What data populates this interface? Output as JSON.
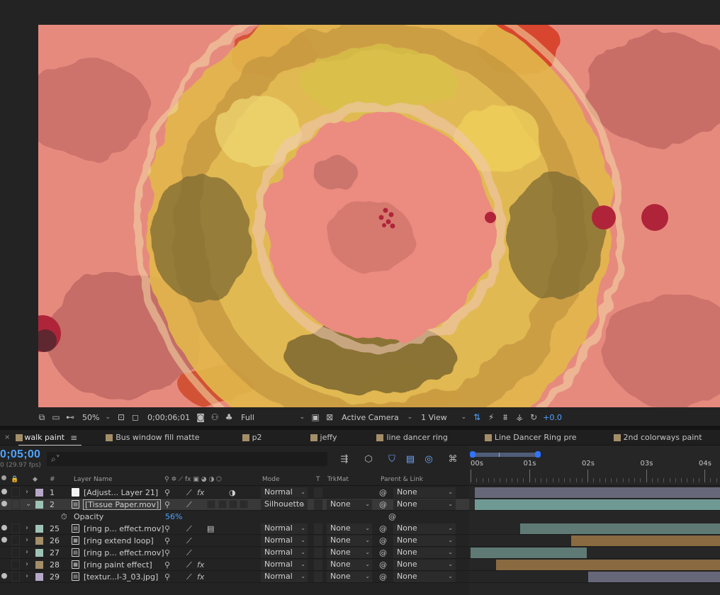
{
  "viewer": {
    "toolbar": {
      "zoom": "50%",
      "timecode": "0;00;06;01",
      "resolution": "Full",
      "camera": "Active Camera",
      "views": "1 View",
      "exposure": "+0.0"
    }
  },
  "tabs": [
    {
      "label": "walk paint",
      "active": true
    },
    {
      "label": "Bus window fill matte"
    },
    {
      "label": "p2"
    },
    {
      "label": "jeffy"
    },
    {
      "label": "line dancer ring"
    },
    {
      "label": "Line Dancer Ring pre"
    },
    {
      "label": "2nd colorways paint"
    }
  ],
  "timeline": {
    "current_time": "0;05;00",
    "fps": "0 (29.97 fps)",
    "search_placeholder": "⌕˅",
    "ruler_labels": [
      "00s",
      "01s",
      "02s",
      "03s",
      "04s"
    ],
    "headers": {
      "num": "#",
      "layer_name": "Layer Name",
      "mode": "Mode",
      "t": "T",
      "trkmat": "TrkMat",
      "parent": "Parent & Link"
    },
    "opacity": {
      "label": "Opacity",
      "value": "56%"
    },
    "layers": [
      {
        "num": "1",
        "name": "[Adjust... Layer 21]",
        "color": "#b7a8c9",
        "type": "solid",
        "mode": "Normal",
        "trkmat": "",
        "parent": "None",
        "fx": true,
        "expanded": false,
        "track_color": "#666879"
      },
      {
        "num": "2",
        "name": "[Tissue Paper.mov]",
        "color": "#9ec3b5",
        "type": "footage",
        "mode": "Silhouette",
        "trkmat": "None",
        "parent": "None",
        "fx": false,
        "expanded": true,
        "selected": true,
        "track_color": "#6f9a94"
      },
      {
        "num": "25",
        "name": "[ring p... effect.mov]",
        "color": "#9ec3b5",
        "type": "footage",
        "mode": "Normal",
        "trkmat": "None",
        "parent": "None",
        "fx": false,
        "expanded": false,
        "track_color": "#5f7a75"
      },
      {
        "num": "26",
        "name": "[ring extend loop]",
        "color": "#a38e69",
        "type": "comp",
        "mode": "Normal",
        "trkmat": "None",
        "parent": "None",
        "fx": false,
        "expanded": false,
        "track_color": "#8a6a40"
      },
      {
        "num": "27",
        "name": "[ring p... effect.mov]",
        "color": "#9ec3b5",
        "type": "footage",
        "mode": "Normal",
        "trkmat": "None",
        "parent": "None",
        "fx": false,
        "expanded": false,
        "track_color": "#5f7a75"
      },
      {
        "num": "28",
        "name": "[ring paint effect]",
        "color": "#a38e69",
        "type": "comp",
        "mode": "Normal",
        "trkmat": "None",
        "parent": "None",
        "fx": true,
        "expanded": false,
        "track_color": "#8a6a40"
      },
      {
        "num": "29",
        "name": "[textur...l-3_03.jpg]",
        "color": "#b7a8c9",
        "type": "footage",
        "mode": "Normal",
        "trkmat": "None",
        "parent": "None",
        "fx": true,
        "expanded": false,
        "track_color": "#666879"
      }
    ]
  },
  "colors": {
    "accent": "#4fa3ff",
    "panel": "#232323",
    "canvas_base": "#e98a7f",
    "ring_yellow": "#e8c24e",
    "dot_red": "#b0243a"
  }
}
